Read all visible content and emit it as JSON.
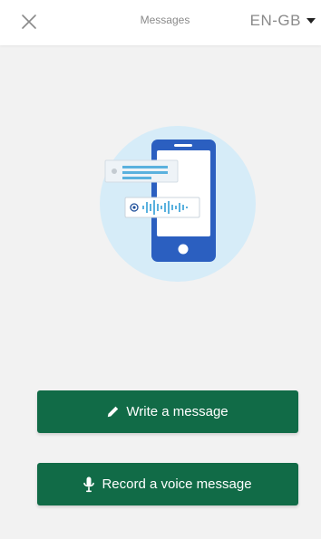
{
  "header": {
    "close_icon": "close-icon",
    "title": "Messages",
    "language": "EN-GB",
    "language_icon": "chevron-down-icon"
  },
  "illustration": {
    "icon": "phone-messages-illustration"
  },
  "actions": {
    "write": {
      "label": "Write a message",
      "icon": "pencil-icon"
    },
    "voice": {
      "label": "Record a voice message",
      "icon": "microphone-icon"
    }
  },
  "colors": {
    "primary_button": "#116b47",
    "background": "#f2f2f2",
    "illustration_circle": "#d6ecf8",
    "phone": "#2b5fc0"
  }
}
